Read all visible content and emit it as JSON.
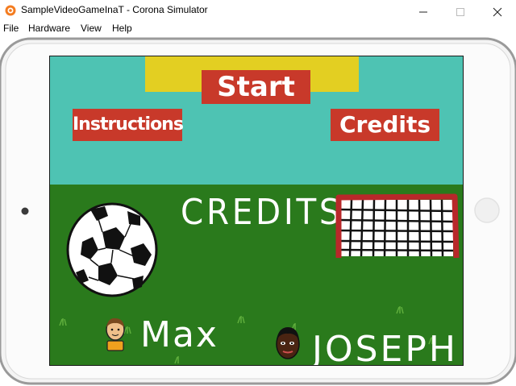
{
  "window": {
    "title": "SampleVideoGameInaT - Corona Simulator",
    "minimize_icon": "minimize-icon",
    "maximize_icon": "maximize-icon",
    "close_icon": "close-icon"
  },
  "menu": {
    "items": [
      "File",
      "Hardware",
      "View",
      "Help"
    ]
  },
  "game": {
    "start_label": "Start",
    "instructions_label": "Instructions",
    "credits_button_label": "Credits",
    "credits_heading": "CREDITS",
    "people": [
      "Max",
      "JOSEPH"
    ]
  },
  "colors": {
    "sky": "#4ec3b3",
    "grass": "#2a7a1c",
    "button_red": "#c8392a",
    "yellow_bar": "#e3cf22",
    "goal_post": "#b8282a"
  }
}
